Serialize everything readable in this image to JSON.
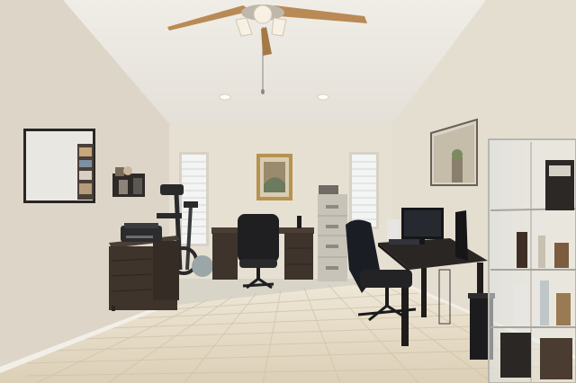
{
  "scene": {
    "kind": "home-office-room-photo",
    "colors": {
      "ceiling": "#e9e6df",
      "back_wall": "#e6e0d3",
      "left_wall": "#ddd6c8",
      "right_wall": "#e4ded1",
      "floor": "#e4dac6",
      "grout": "#cfc3ab",
      "dark_wood": "#3e342c",
      "black": "#1c1c1e",
      "file_cabinet": "#c8c3b8",
      "fan_blade": "#b98a55",
      "fan_light": "#f6f1e3",
      "picture_frame": "#b8924f",
      "window_glass": "#f3f4f4"
    },
    "objects": [
      "ceiling-fan",
      "recessed-light",
      "whiteboard",
      "wall-shelf",
      "framed-picture",
      "window",
      "dresser",
      "printer",
      "exercise-bike",
      "desk",
      "office-chair",
      "file-cabinet",
      "computer-desk",
      "monitor",
      "desk-chair",
      "mirror",
      "glass-display-cabinet",
      "trash-can"
    ]
  }
}
